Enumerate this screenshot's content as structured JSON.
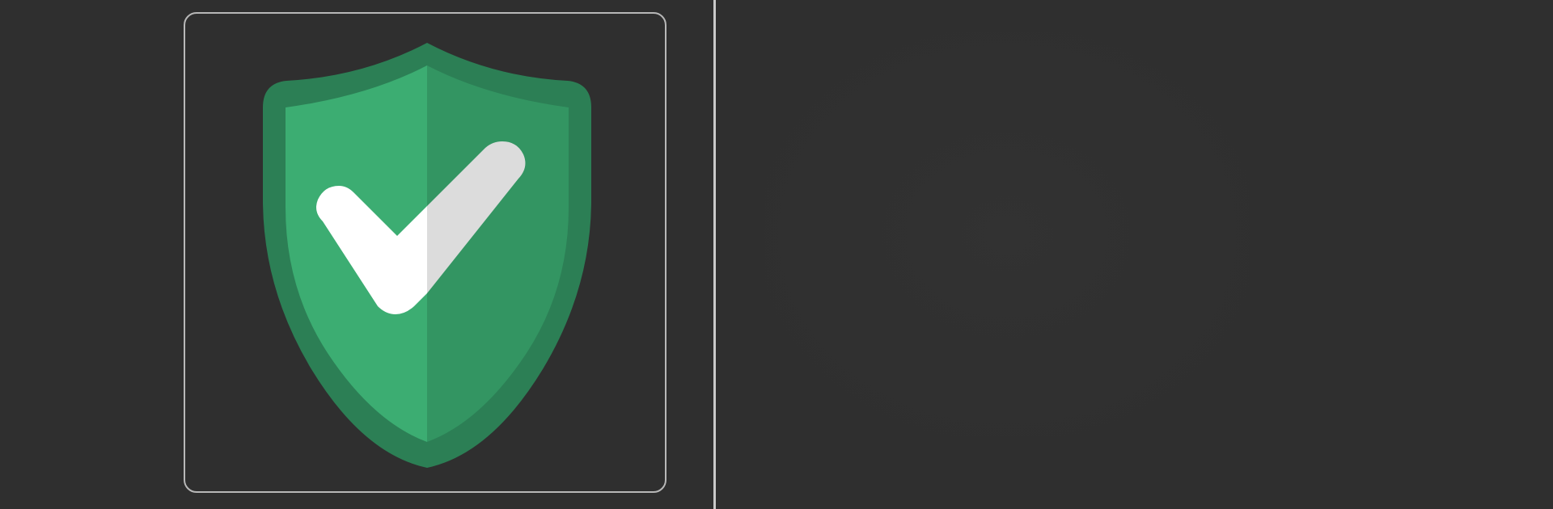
{
  "icons": {
    "selected": "shield-check-icon",
    "preview": "empty-preview-placeholder"
  },
  "colors": {
    "background": "#2f2f2f",
    "tile_border": "#b8b8b8",
    "divider": "#c9c9c9",
    "shield_outer": "#2c7f55",
    "shield_inner_left": "#3cad72",
    "shield_inner_right": "#339562",
    "check_left": "#ffffff",
    "check_right": "#dcdcdc"
  }
}
